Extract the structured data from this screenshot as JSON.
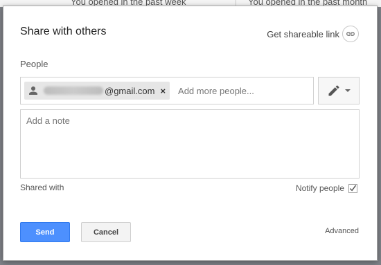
{
  "background": {
    "left_text": "You opened in the past week",
    "right_text": "You opened in the past month"
  },
  "dialog": {
    "title": "Share with others",
    "shareable_link_label": "Get shareable link",
    "shareable_link_icon": "link-icon",
    "people_label": "People",
    "chip": {
      "email_suffix": "@gmail.com",
      "remove_glyph": "×",
      "icon": "person-icon"
    },
    "add_people_placeholder": "Add more people...",
    "permission_icon": "pencil-icon",
    "note_placeholder": "Add a note",
    "shared_with_label": "Shared with",
    "notify_label": "Notify people",
    "notify_checked": true,
    "send_label": "Send",
    "cancel_label": "Cancel",
    "advanced_label": "Advanced"
  },
  "colors": {
    "primary_button": "#4d90fe",
    "overlay": "#7f8288"
  }
}
